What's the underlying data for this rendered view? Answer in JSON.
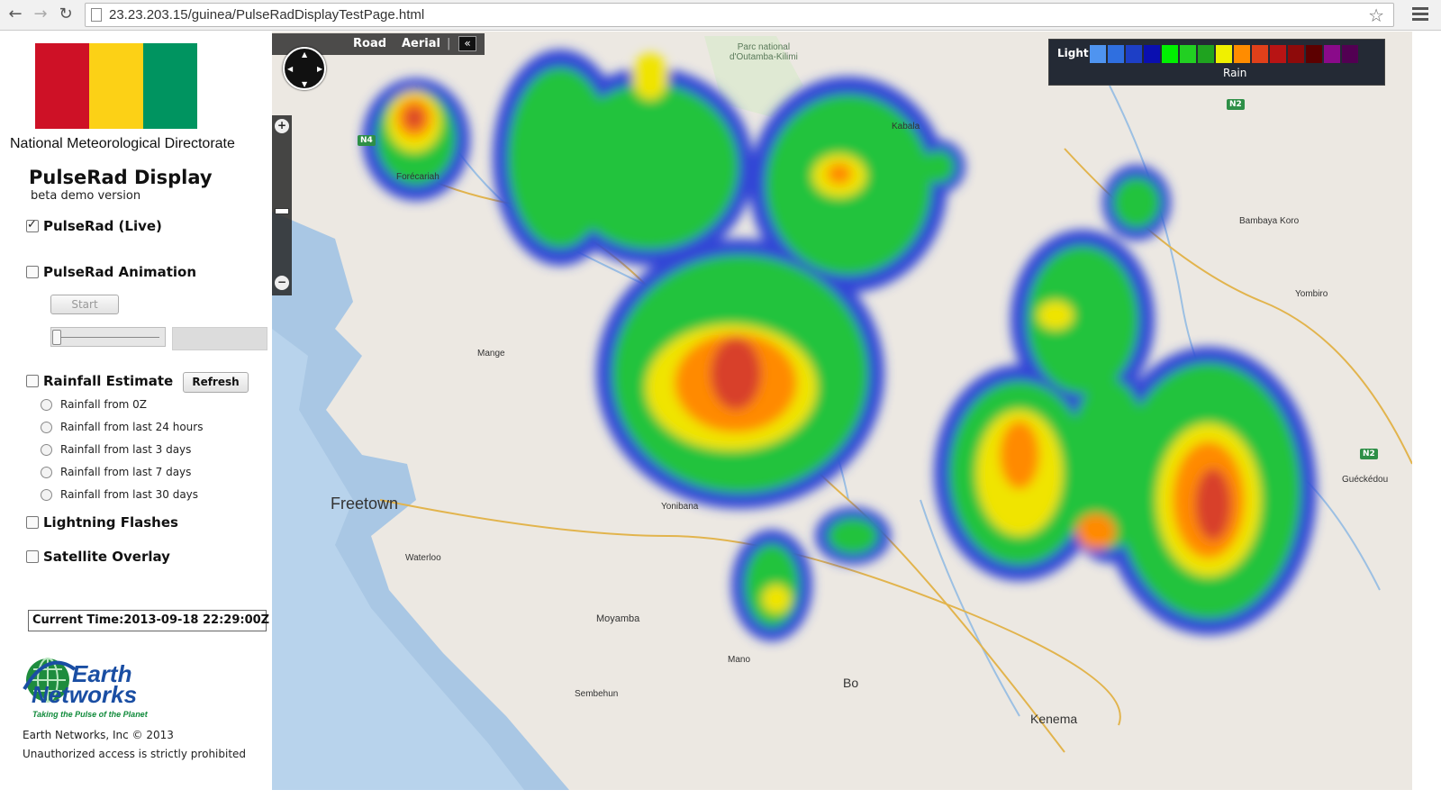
{
  "browser": {
    "url": "23.23.203.15/guinea/PulseRadDisplayTestPage.html",
    "back_icon": "back-arrow-icon",
    "forward_icon": "forward-arrow-icon",
    "reload_icon": "reload-icon"
  },
  "sidebar": {
    "flag_colors": [
      "#ce1126",
      "#fcd116",
      "#009460"
    ],
    "directorate": "National Meteorological Directorate",
    "app_title": "PulseRad Display",
    "app_subtitle": "beta demo version",
    "pulserad_live": {
      "label": "PulseRad (Live)",
      "checked": true
    },
    "pulserad_animation": {
      "label": "PulseRad Animation",
      "checked": false
    },
    "start_label": "Start",
    "rainfall_estimate": {
      "label": "Rainfall Estimate",
      "checked": false
    },
    "refresh_label": "Refresh",
    "rainfall_options": [
      "Rainfall from 0Z",
      "Rainfall from last 24 hours",
      "Rainfall from last 3 days",
      "Rainfall from last 7 days",
      "Rainfall from last 30 days"
    ],
    "lightning": {
      "label": "Lightning Flashes",
      "checked": false
    },
    "satellite": {
      "label": "Satellite Overlay",
      "checked": false
    },
    "current_time": "Current Time:2013-09-18 22:29:00Z",
    "logo": {
      "line1": "Earth",
      "line2": "Networks",
      "tagline": "Taking the Pulse of the Planet"
    },
    "copyright": "Earth Networks, Inc © 2013",
    "warning": "Unauthorized access is strictly prohibited"
  },
  "map": {
    "road_label": "Road",
    "aerial_label": "Aerial",
    "collapse_label": "«",
    "legend": {
      "light_label": "Light",
      "rain_label": "Rain",
      "colors": [
        "#4f94f0",
        "#2f6fe0",
        "#1d3fc6",
        "#0a0fb0",
        "#00f000",
        "#22cf22",
        "#1fa31f",
        "#f0f000",
        "#ff8c00",
        "#e0401a",
        "#b81414",
        "#8e0a0a",
        "#5c0000",
        "#8a0a8a",
        "#520052"
      ]
    },
    "places": {
      "freetown": "Freetown",
      "mange": "Mange",
      "yonibana": "Yonibana",
      "waterloo": "Waterloo",
      "moyamba": "Moyamba",
      "mano": "Mano",
      "sembehun": "Sembehun",
      "bo": "Bo",
      "kenema": "Kenema",
      "forecariah": "Forécariah",
      "kabala": "Kabala",
      "park": "Parc national\nd'Outamba-Kilimi",
      "bambaya": "Bambaya Koro",
      "yombiro": "Yombiro",
      "gueckedou": "Guéckédou"
    },
    "roads": {
      "n4": "N4",
      "n2a": "N2",
      "n2b": "N2"
    }
  }
}
